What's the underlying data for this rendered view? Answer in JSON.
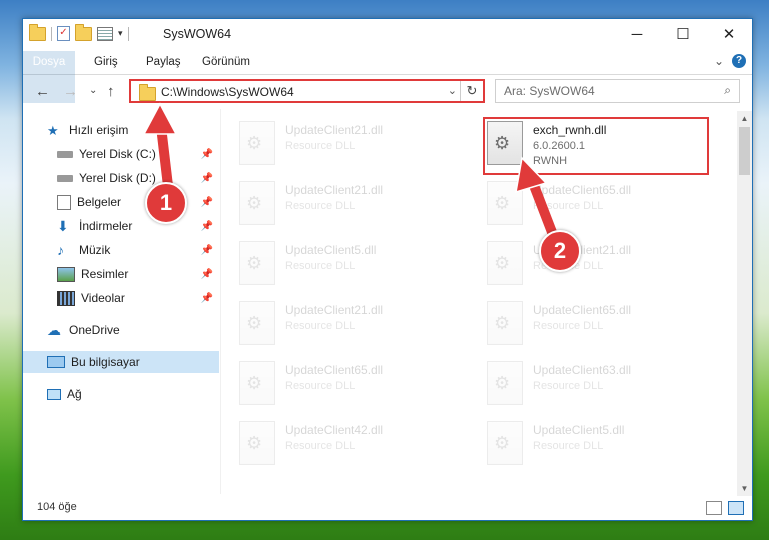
{
  "window": {
    "title": "SysWOW64",
    "minimize": "─",
    "maximize": "☐",
    "close": "✕"
  },
  "ribbon": {
    "tabs": [
      {
        "label": "Dosya"
      },
      {
        "label": "Giriş"
      },
      {
        "label": "Paylaş"
      },
      {
        "label": "Görünüm"
      }
    ],
    "expand": "⌄",
    "help": "?"
  },
  "address": {
    "path": "C:\\Windows\\SysWOW64",
    "dropdown": "⌄",
    "refresh": "↻",
    "back": "←",
    "forward": "→",
    "recent": "⌄",
    "up": "↑"
  },
  "search": {
    "placeholder": "Ara: SysWOW64",
    "icon": "⌕"
  },
  "sidebar": {
    "items": [
      {
        "label": "Hızlı erişim",
        "icon": "star-icon"
      },
      {
        "label": "Yerel Disk (C:)",
        "icon": "drive-icon"
      },
      {
        "label": "Yerel Disk (D:)",
        "icon": "drive-icon"
      },
      {
        "label": "Belgeler",
        "icon": "documents-icon"
      },
      {
        "label": "İndirmeler",
        "icon": "download-icon"
      },
      {
        "label": "Müzik",
        "icon": "music-icon"
      },
      {
        "label": "Resimler",
        "icon": "pictures-icon"
      },
      {
        "label": "Videolar",
        "icon": "video-icon"
      },
      {
        "label": "OneDrive",
        "icon": "cloud-icon"
      },
      {
        "label": "Bu bilgisayar",
        "icon": "computer-icon"
      },
      {
        "label": "Ağ",
        "icon": "network-icon"
      }
    ]
  },
  "files": {
    "left": [
      {
        "name": "UpdateClient21.dll",
        "desc": "Resource DLL"
      },
      {
        "name": "UpdateClient21.dll",
        "desc": "Resource DLL"
      },
      {
        "name": "UpdateClient5.dll",
        "desc": "Resource DLL"
      },
      {
        "name": "UpdateClient21.dll",
        "desc": "Resource DLL"
      },
      {
        "name": "UpdateClient65.dll",
        "desc": "Resource DLL"
      },
      {
        "name": "UpdateClient42.dll",
        "desc": "Resource DLL"
      }
    ],
    "right": [
      {
        "name": "exch_rwnh.dll",
        "desc": "6.0.2600.1",
        "desc2": "RWNH"
      },
      {
        "name": "UpdateClient65.dll",
        "desc": "Resource DLL"
      },
      {
        "name": "UpdateClient21.dll",
        "desc": "Resource DLL"
      },
      {
        "name": "UpdateClient65.dll",
        "desc": "Resource DLL"
      },
      {
        "name": "UpdateClient63.dll",
        "desc": "Resource DLL"
      },
      {
        "name": "UpdateClient5.dll",
        "desc": "Resource DLL"
      }
    ]
  },
  "status": {
    "count": "104 öğe"
  },
  "annotations": {
    "step1": "1",
    "step2": "2",
    "color": "#e03a3a"
  }
}
